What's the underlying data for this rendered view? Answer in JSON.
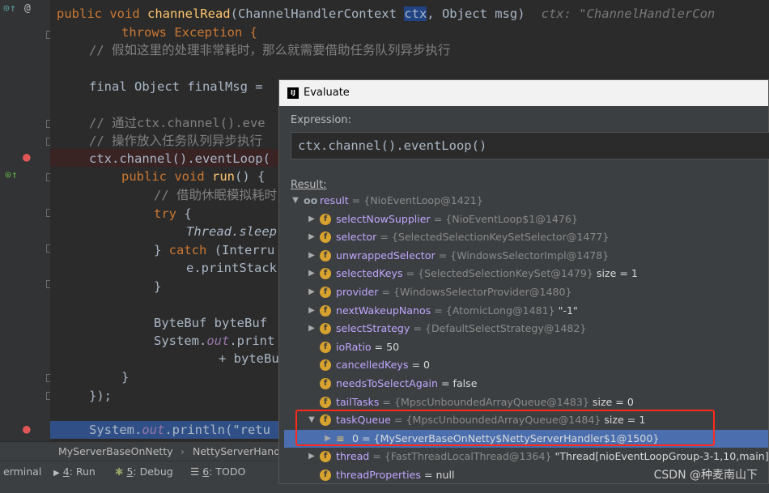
{
  "editor": {
    "lines": {
      "l1_kw": "public void ",
      "l1_fn": "channelRead",
      "l1_rest": "(ChannelHandlerContext ",
      "l1_ctx": "ctx",
      "l1_rest2": ", Object msg)",
      "l1_hint": "ctx: \"ChannelHandlerCon",
      "l2": "throws Exception {",
      "l3": "// 假如这里的处理非常耗时，那么就需要借助任务队列异步执行",
      "l4": "final Object finalMsg = ",
      "l5": "// 通过ctx.channel().eve",
      "l6": "// 操作放入任务队列异步执行",
      "l7": "ctx.channel().eventLoop(",
      "l8_kw": "public void ",
      "l8_fn": "run",
      "l8_rest": "() {",
      "l9": "// 借助休眠模拟耗时",
      "l10_kw": "try",
      "l10_rest": " {",
      "l11": "Thread.sleep",
      "l12_rest": "} ",
      "l12_kw": "catch",
      "l12_rest2": " (Interru",
      "l13": "e.printStack",
      "l14": "}",
      "l15": "ByteBuf byteBuf ",
      "l16_a": "System.",
      "l16_b": "out",
      "l16_c": ".print",
      "l17": "+ byteBu",
      "l18": "}",
      "l19": "});",
      "l20_a": "System.",
      "l20_b": "out",
      "l20_c": ".println(\"retu"
    }
  },
  "breadcrumb": {
    "item1": "MyServerBaseOnNetty",
    "sep": "›",
    "item2": "NettyServerHand"
  },
  "toolbar": {
    "terminal": "erminal",
    "run_num": "4",
    "run_label": ": Run",
    "debug_num": "5",
    "debug_label": ": Debug",
    "todo_num": "6",
    "todo_label": ": TODO"
  },
  "dialog": {
    "title": "Evaluate",
    "expression_label": "Expression:",
    "expression": "ctx.channel().eventLoop()",
    "result_label": "Result:",
    "root": {
      "name": "result",
      "value": " = {NioEventLoop@1421}"
    },
    "fields": [
      {
        "name": "selectNowSupplier",
        "value": " = {NioEventLoop$1@1476}",
        "extra": ""
      },
      {
        "name": "selector",
        "value": " = {SelectedSelectionKeySetSelector@1477}",
        "extra": ""
      },
      {
        "name": "unwrappedSelector",
        "value": " = {WindowsSelectorImpl@1478}",
        "extra": ""
      },
      {
        "name": "selectedKeys",
        "value": " = {SelectedSelectionKeySet@1479}",
        "extra": "  size = 1"
      },
      {
        "name": "provider",
        "value": " = {WindowsSelectorProvider@1480}",
        "extra": ""
      },
      {
        "name": "nextWakeupNanos",
        "value": " = {AtomicLong@1481}",
        "extra": " \"-1\""
      },
      {
        "name": "selectStrategy",
        "value": " = {DefaultSelectStrategy@1482}",
        "extra": ""
      },
      {
        "name": "ioRatio",
        "value": "",
        "extra": " = 50"
      },
      {
        "name": "cancelledKeys",
        "value": "",
        "extra": " = 0"
      },
      {
        "name": "needsToSelectAgain",
        "value": "",
        "extra": " = false"
      },
      {
        "name": "tailTasks",
        "value": " = {MpscUnboundedArrayQueue@1483}",
        "extra": "  size = 0"
      },
      {
        "name": "taskQueue",
        "value": " = {MpscUnboundedArrayQueue@1484}",
        "extra": "  size = 1"
      },
      {
        "name": "0",
        "value": " = {MyServerBaseOnNetty$NettyServerHandler$1@1500}",
        "extra": ""
      },
      {
        "name": "thread",
        "value": " = {FastThreadLocalThread@1364}",
        "extra": " \"Thread[nioEventLoopGroup-3-1,10,main]\""
      },
      {
        "name": "threadProperties",
        "value": "",
        "extra": " = null"
      }
    ]
  },
  "watermark": "CSDN @种麦南山下",
  "colors": {
    "selection": "#4b6eaf",
    "highlight_box": "#ff2a1a",
    "keyword": "#cc7832",
    "function": "#ffc66d"
  }
}
